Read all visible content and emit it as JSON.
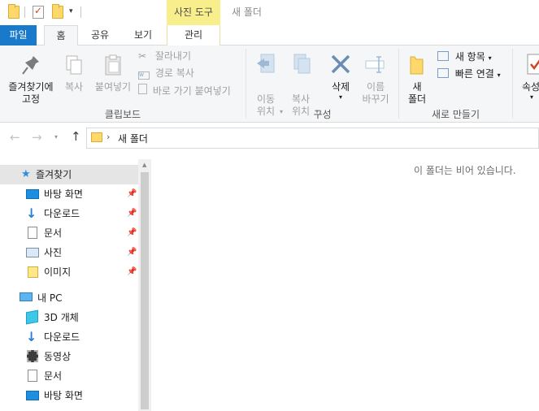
{
  "window": {
    "title": "새 폴더",
    "context_tab_group": "사진 도구"
  },
  "tabs": {
    "file": "파일",
    "home": "홈",
    "share": "공유",
    "view": "보기",
    "manage": "관리"
  },
  "ribbon": {
    "clipboard": {
      "label": "클립보드",
      "pin_quick_access": "즐겨찾기에\n고정",
      "copy": "복사",
      "paste": "붙여넣기",
      "cut": "잘라내기",
      "copy_path": "경로 복사",
      "paste_shortcut": "바로 가기 붙여넣기"
    },
    "organize": {
      "label": "구성",
      "move_to": "이동\n위치",
      "copy_to": "복사\n위치",
      "delete": "삭제",
      "rename": "이름\n바꾸기"
    },
    "new": {
      "label": "새로 만들기",
      "new_folder": "새\n폴더",
      "new_item": "새 항목",
      "easy_access": "빠른 연결"
    },
    "open": {
      "properties": "속성"
    }
  },
  "address": {
    "path": "새 폴더"
  },
  "nav": {
    "quick_access": "즐겨찾기",
    "quick_items": [
      "바탕 화면",
      "다운로드",
      "문서",
      "사진",
      "이미지"
    ],
    "this_pc": "내 PC",
    "pc_items": [
      "3D 개체",
      "다운로드",
      "동영상",
      "문서",
      "바탕 화면"
    ]
  },
  "content": {
    "empty_message": "이 폴더는 비어 있습니다."
  },
  "colors": {
    "accent": "#1979ca",
    "context_tab": "#f8ef8c",
    "selected_nav": "#e5f3ff"
  }
}
